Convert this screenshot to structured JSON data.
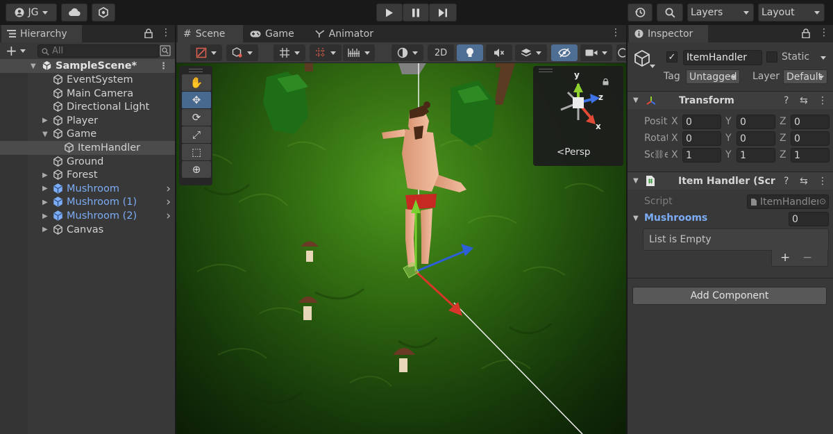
{
  "toolbar": {
    "account": "JG",
    "layers": "Layers",
    "layout": "Layout"
  },
  "hierarchy": {
    "tab": "Hierarchy",
    "search_placeholder": "All",
    "scene": "SampleScene*",
    "items": [
      {
        "label": "EventSystem"
      },
      {
        "label": "Main Camera"
      },
      {
        "label": "Directional Light"
      },
      {
        "label": "Player"
      },
      {
        "label": "Game"
      },
      {
        "label": "ItemHandler"
      },
      {
        "label": "Ground"
      },
      {
        "label": "Forest"
      },
      {
        "label": "Mushroom"
      },
      {
        "label": "Mushroom (1)"
      },
      {
        "label": "Mushroom (2)"
      },
      {
        "label": "Canvas"
      }
    ]
  },
  "scene": {
    "tabs": [
      "Scene",
      "Game",
      "Animator"
    ],
    "mode_2d": "2D",
    "projection": "Persp",
    "axes": {
      "x": "x",
      "y": "y",
      "z": "z"
    }
  },
  "inspector": {
    "tab": "Inspector",
    "object_name": "ItemHandler",
    "static_label": "Static",
    "tag_label": "Tag",
    "tag_value": "Untagged",
    "layer_label": "Layer",
    "layer_value": "Default",
    "transform": {
      "title": "Transform",
      "position_label": "Position",
      "rotation_label": "Rotation",
      "scale_label": "Scale",
      "position": [
        "0",
        "0",
        "0"
      ],
      "rotation": [
        "0",
        "0",
        "0"
      ],
      "scale": [
        "1",
        "1",
        "1"
      ],
      "axis_labels": [
        "X",
        "Y",
        "Z"
      ]
    },
    "script_component": {
      "title": "Item Handler (Script)",
      "script_label": "Script",
      "script_value": "ItemHandler",
      "list_label": "Mushrooms",
      "list_count": "0",
      "list_empty": "List is Empty",
      "add": "+",
      "remove": "−"
    },
    "add_component": "Add Component"
  },
  "colors": {
    "panel": "#383838",
    "prefab_blue": "#7cacf5",
    "accent": "#47688f"
  }
}
